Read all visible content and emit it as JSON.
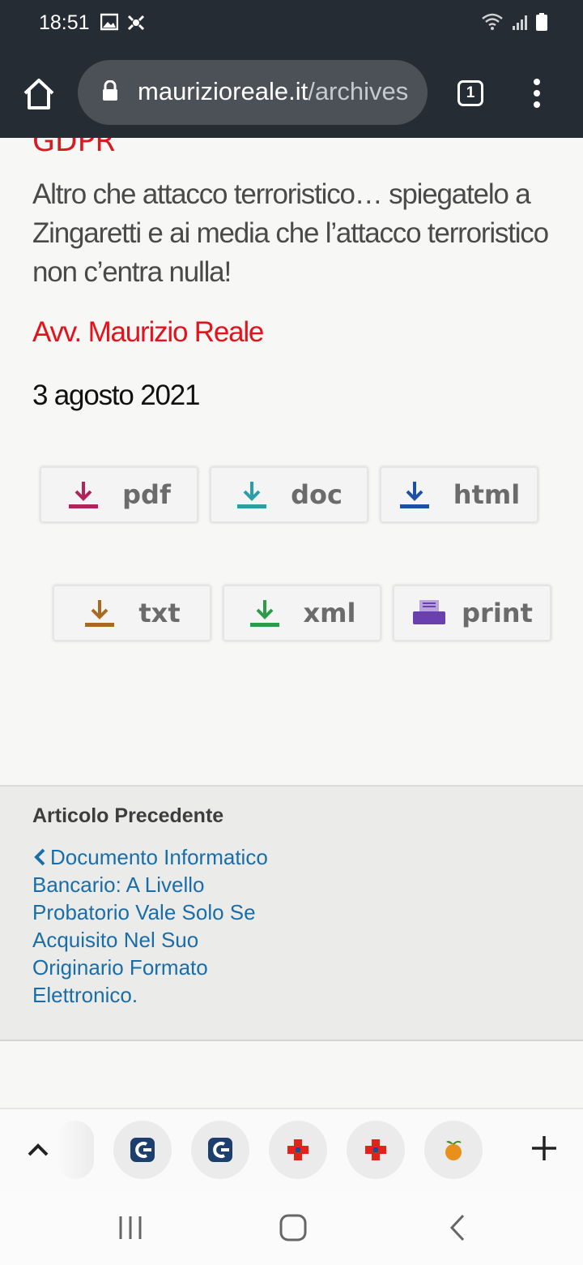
{
  "status_bar": {
    "time": "18:51"
  },
  "browser": {
    "url_domain": "mauriziorealeit",
    "url_domain_display": "maurizioreale.it",
    "url_path": "/archives",
    "tab_count": "1"
  },
  "article": {
    "cut_title": "GDPR",
    "body": "Altro che attacco terroristico… spiegatelo a Zingaretti e ai media che l’attacco terroristico non c’entra nulla!",
    "author": "Avv. Maurizio Reale",
    "date": "3 agosto 2021"
  },
  "downloads": [
    {
      "label": "pdf",
      "color": "#b0235b"
    },
    {
      "label": "doc",
      "color": "#2a9fa7"
    },
    {
      "label": "html",
      "color": "#1d4fa3"
    },
    {
      "label": "txt",
      "color": "#a86a22"
    },
    {
      "label": "xml",
      "color": "#2c9c4a"
    },
    {
      "label": "print",
      "color": "#6a3fb0"
    }
  ],
  "previous_article": {
    "heading": "Articolo Precedente",
    "link": "Documento Informatico Bancario: A Livello Probatorio Vale Solo Se Acquisito Nel Suo Originario Formato Elettronico."
  },
  "tab_strip": {
    "tabs": [
      {
        "icon": "cc-logo-icon"
      },
      {
        "icon": "cc-logo-icon"
      },
      {
        "icon": "red-cross-icon"
      },
      {
        "icon": "red-cross-icon"
      },
      {
        "icon": "orange-icon"
      }
    ]
  }
}
